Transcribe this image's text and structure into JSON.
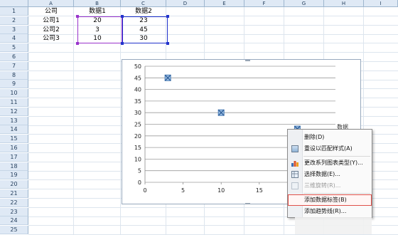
{
  "sheet": {
    "columns": [
      "A",
      "B",
      "C",
      "D",
      "E",
      "F",
      "G",
      "H",
      "I"
    ],
    "rows": [
      "1",
      "2",
      "3",
      "4",
      "5",
      "6",
      "7",
      "8",
      "9",
      "10",
      "11",
      "12",
      "13",
      "14",
      "15",
      "16",
      "17",
      "18",
      "19",
      "20",
      "21",
      "22",
      "23",
      "24",
      "25"
    ],
    "cells": {
      "a1": "公司",
      "b1": "数据1",
      "c1": "数据2",
      "a2": "公司1",
      "b2": "20",
      "c2": "23",
      "a3": "公司2",
      "b3": "3",
      "c3": "45",
      "a4": "公司3",
      "b4": "10",
      "c4": "30"
    },
    "selection_colors": {
      "x_range": "#9933cc",
      "y_range": "#2233cc"
    }
  },
  "chart_data": {
    "type": "scatter",
    "x": [
      3,
      10,
      20
    ],
    "y": [
      45,
      30,
      23
    ],
    "xlim": [
      0,
      25
    ],
    "ylim": [
      0,
      50
    ],
    "x_ticks": [
      "0",
      "5",
      "10",
      "15",
      "20",
      "25"
    ],
    "y_ticks": [
      "0",
      "5",
      "10",
      "15",
      "20",
      "25",
      "30",
      "35",
      "40",
      "45",
      "50"
    ],
    "title": "",
    "xlabel": "",
    "ylabel": "",
    "grid": "horizontal",
    "marker_color": "#4a7eb8"
  },
  "chart_partial_legend": "数据",
  "context_menu": {
    "items": [
      {
        "label": "删除(D)",
        "disabled": false,
        "icon": "none"
      },
      {
        "label": "重设以匹配样式(A)",
        "disabled": false,
        "icon": "reset-style-icon"
      },
      {
        "label": "更改系列图表类型(Y)...",
        "disabled": false,
        "icon": "change-chart-type-icon"
      },
      {
        "label": "选择数据(E)...",
        "disabled": false,
        "icon": "select-data-icon"
      },
      {
        "label": "三维旋转(R)...",
        "disabled": true,
        "icon": "3d-rotation-icon"
      },
      {
        "label": "添加数据标签(B)",
        "disabled": false,
        "icon": "none",
        "highlighted": true
      },
      {
        "label": "添加趋势线(R)...",
        "disabled": false,
        "icon": "none"
      }
    ]
  }
}
